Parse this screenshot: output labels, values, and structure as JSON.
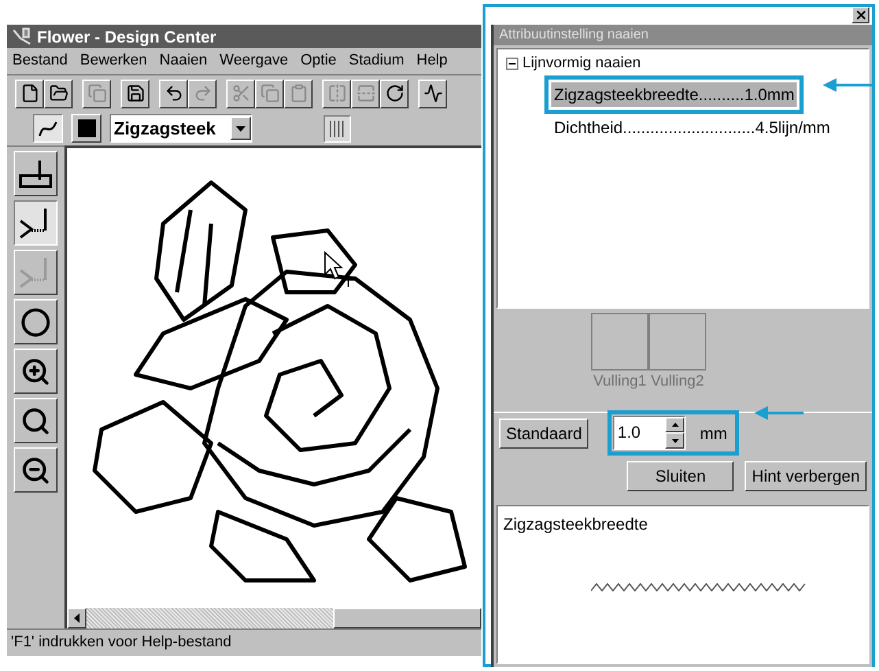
{
  "window": {
    "title": "Flower - Design Center"
  },
  "menu": [
    "Bestand",
    "Bewerken",
    "Naaien",
    "Weergave",
    "Optie",
    "Stadium",
    "Help"
  ],
  "toolbar": [
    {
      "disabled": false
    },
    {
      "disabled": false
    },
    {
      "disabled": true
    },
    {
      "disabled": false
    },
    {
      "disabled": false
    },
    {
      "disabled": true
    },
    {
      "disabled": true
    },
    {
      "disabled": true
    },
    {
      "disabled": true
    },
    {
      "disabled": true
    },
    {
      "disabled": true
    },
    {
      "disabled": false
    },
    {
      "disabled": false
    }
  ],
  "stitch_bar": {
    "line_tool_selected": true,
    "stitch_type": "Zigzagsteek"
  },
  "tools": [
    {
      "selected": false,
      "disabled": false
    },
    {
      "selected": true,
      "disabled": false
    },
    {
      "selected": false,
      "disabled": true
    },
    {
      "selected": false,
      "disabled": false
    },
    {
      "selected": false,
      "disabled": false
    },
    {
      "selected": false,
      "disabled": false
    },
    {
      "selected": false,
      "disabled": false
    }
  ],
  "status_bar": "'F1' indrukken voor Help-bestand",
  "dialog": {
    "title": "Attribuutinstelling naaien",
    "tree": [
      {
        "label": "Lijnvormig naaien",
        "expanded": true,
        "children": [
          {
            "label": "Zigzagsteekbreedte..........1.0mm",
            "selected": true
          },
          {
            "label": "Dichtheid.............................4.5lijn/mm",
            "selected": false
          }
        ]
      }
    ],
    "fills": [
      {
        "label": "Vulling1",
        "disabled": true
      },
      {
        "label": "Vulling2",
        "disabled": true
      }
    ],
    "default_button": "Standaard",
    "spin": {
      "value": "1.0",
      "unit": "mm"
    },
    "buttons": [
      "Sluiten",
      "Hint verbergen"
    ],
    "hint_title": "Zigzagsteekbreedte"
  }
}
